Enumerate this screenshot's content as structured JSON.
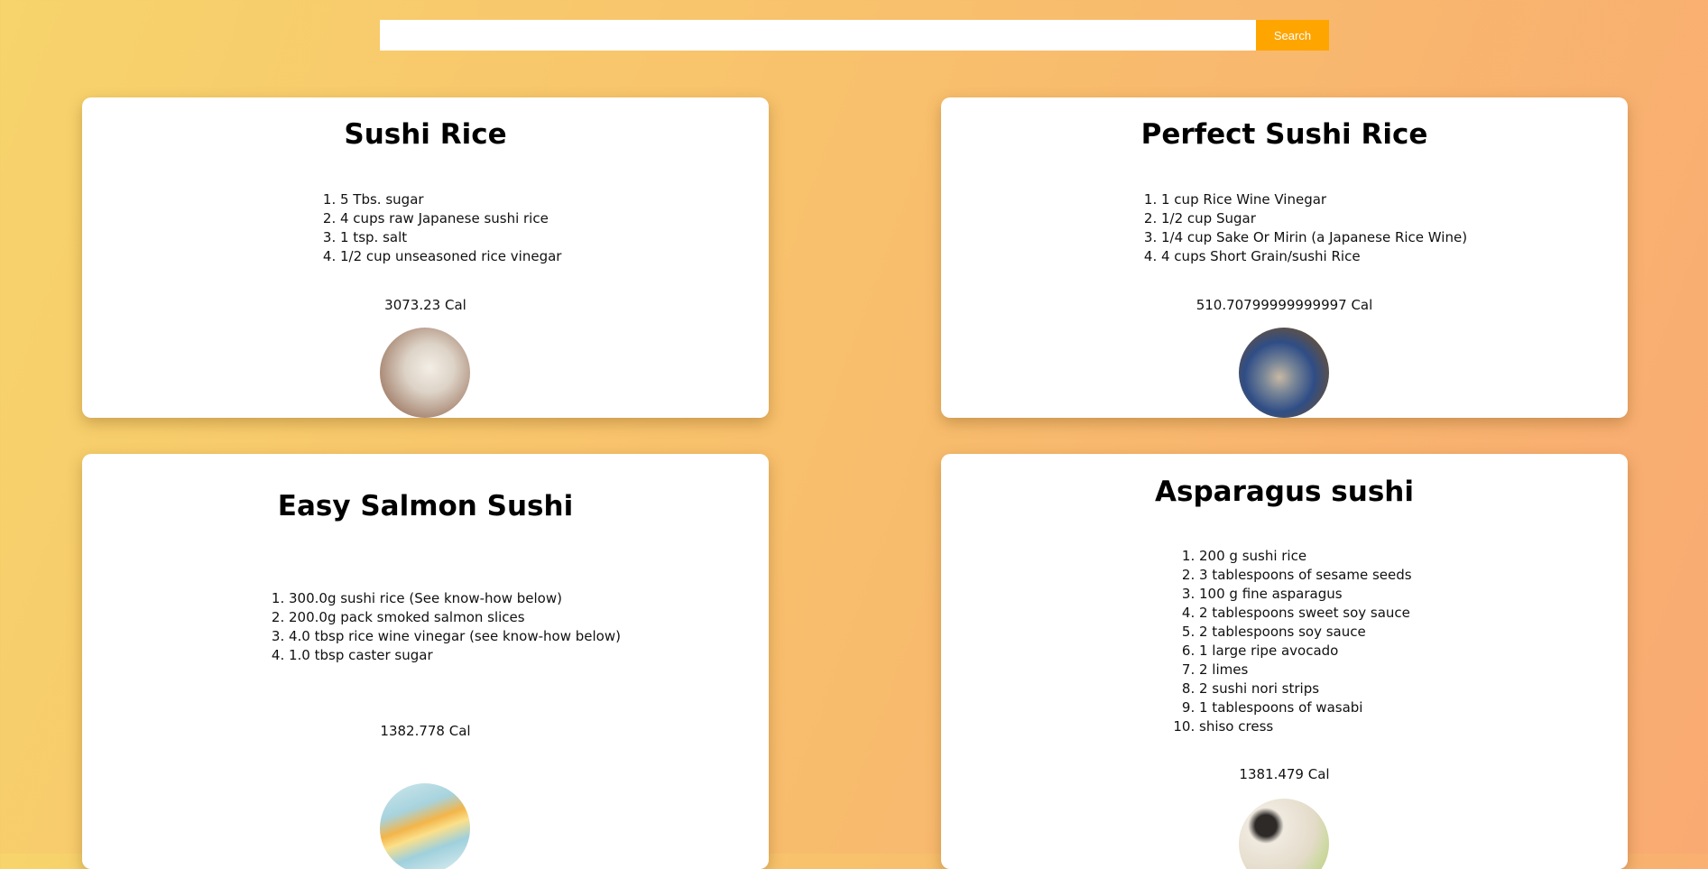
{
  "search": {
    "placeholder": "",
    "value": "",
    "button_label": "Search"
  },
  "recipes": [
    {
      "title": "Sushi Rice",
      "ingredients": [
        "5 Tbs. sugar",
        "4 cups raw Japanese sushi rice",
        "1 tsp. salt",
        "1/2 cup unseasoned rice vinegar"
      ],
      "calories": "3073.23 Cal",
      "image_alt": "sushi rice"
    },
    {
      "title": "Perfect Sushi Rice",
      "ingredients": [
        "1 cup Rice Wine Vinegar",
        "1/2 cup Sugar",
        "1/4 cup Sake Or Mirin (a Japanese Rice Wine)",
        "4 cups Short Grain/sushi Rice"
      ],
      "calories": "510.70799999999997 Cal",
      "image_alt": "perfect sushi rice"
    },
    {
      "title": "Easy Salmon Sushi",
      "ingredients": [
        "300.0g sushi rice (See know-how below)",
        "200.0g pack smoked salmon slices",
        "4.0 tbsp rice wine vinegar (see know-how below)",
        "1.0 tbsp caster sugar"
      ],
      "calories": "1382.778 Cal",
      "image_alt": "easy salmon sushi"
    },
    {
      "title": "Asparagus sushi",
      "ingredients": [
        "200 g sushi rice",
        "3 tablespoons of sesame seeds",
        "100 g fine asparagus",
        "2 tablespoons sweet soy sauce",
        "2 tablespoons soy sauce",
        "1 large ripe avocado",
        "2 limes",
        "2 sushi nori strips",
        "1 tablespoons of wasabi",
        "shiso cress"
      ],
      "calories": "1381.479 Cal",
      "image_alt": "asparagus sushi"
    }
  ]
}
